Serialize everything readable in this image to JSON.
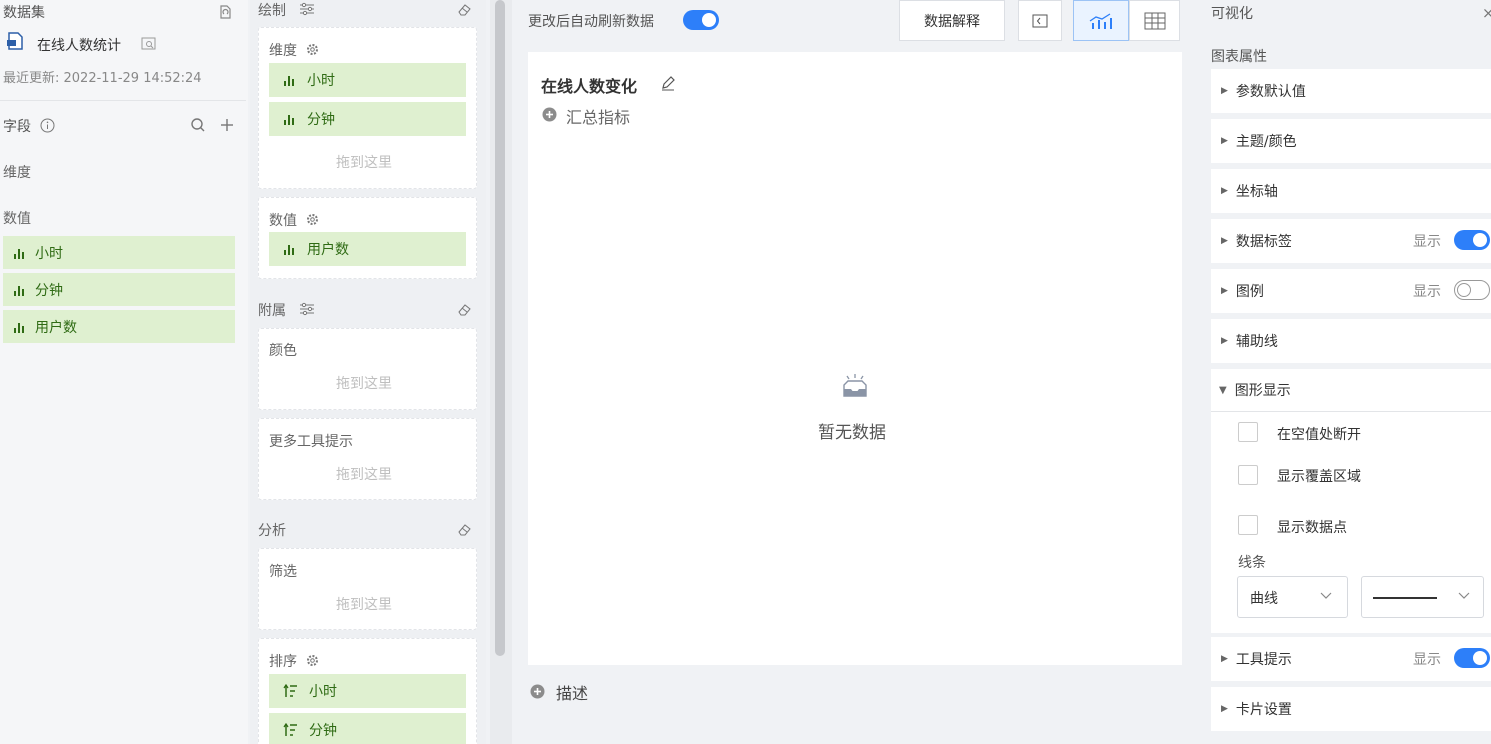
{
  "dataset": {
    "title": "数据集",
    "name": "在线人数统计",
    "updated": "最近更新: 2022-11-29 14:52:24",
    "fields_label": "字段",
    "dimension_label": "维度",
    "value_label": "数值",
    "fields": [
      "小时",
      "分钟",
      "用户数"
    ]
  },
  "config": {
    "draw_label": "绘制",
    "dimension_title": "维度",
    "dimension_items": [
      "小时",
      "分钟"
    ],
    "drop_hint": "拖到这里",
    "value_title": "数值",
    "value_items": [
      "用户数"
    ],
    "attach_label": "附属",
    "color_title": "颜色",
    "tooltip_title": "更多工具提示",
    "analysis_label": "分析",
    "filter_title": "筛选",
    "sort_title": "排序",
    "sort_items": [
      "小时",
      "分钟"
    ]
  },
  "main": {
    "auto_refresh_label": "更改后自动刷新数据",
    "data_explain_label": "数据解释",
    "chart_title": "在线人数变化",
    "summary_label": "汇总指标",
    "empty_text": "暂无数据",
    "describe_label": "描述"
  },
  "right": {
    "title": "可视化",
    "section_title": "图表属性",
    "show_label": "显示",
    "rows": [
      "参数默认值",
      "主题/颜色",
      "坐标轴",
      "数据标签",
      "图例",
      "辅助线",
      "图形显示"
    ],
    "checkboxes": [
      "在空值处断开",
      "显示覆盖区域",
      "显示数据点"
    ],
    "line_label": "线条",
    "line_type": "曲线",
    "bottom_rows": [
      "工具提示",
      "卡片设置"
    ]
  },
  "colors": {
    "accent": "#2d7ff9",
    "pill_bg": "#dff0d0",
    "pill_text": "#2f6b14"
  }
}
